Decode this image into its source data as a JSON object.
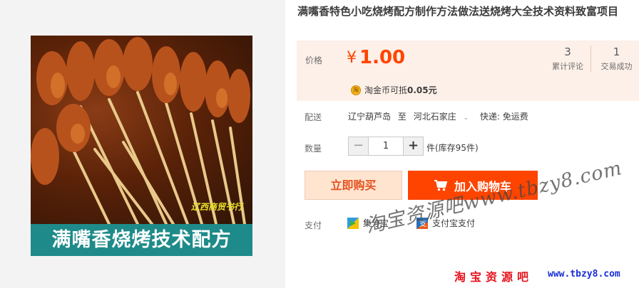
{
  "product": {
    "title": "满嘴香特色小吃烧烤配方制作方法做法送烧烤大全技术资料致富项目",
    "image_caption": "满嘴香烧烤技术配方",
    "image_watermark": "辽西商贸书行"
  },
  "price": {
    "label": "价格",
    "currency": "¥",
    "value": "1.00",
    "accent_color": "#ff4400"
  },
  "stats": [
    {
      "num": "3",
      "label": "累计评论"
    },
    {
      "num": "1",
      "label": "交易成功"
    }
  ],
  "coin": {
    "icon": "taojinbi-coin-icon",
    "text": "淘金币可抵",
    "amount": "0.05元"
  },
  "shipping": {
    "label": "配送",
    "from": "辽宁葫芦岛",
    "to_word": "至",
    "to": "河北石家庄",
    "fee": "快递: 免运费"
  },
  "quantity": {
    "label": "数量",
    "value": "1",
    "minus": "−",
    "plus": "+",
    "stock": "件(库存95件)"
  },
  "actions": {
    "buy_now": "立即购买",
    "add_cart": "加入购物车"
  },
  "payment": {
    "label": "支付",
    "methods": [
      {
        "name": "集分宝",
        "icon": "jifenbao-icon"
      },
      {
        "name": "支付宝支付",
        "icon": "alipay-icon"
      }
    ]
  },
  "watermarks": {
    "diagonal": "淘宝资源吧www.tbzy8.com",
    "red": "淘宝资源吧",
    "url": "www.tbzy8.com"
  }
}
